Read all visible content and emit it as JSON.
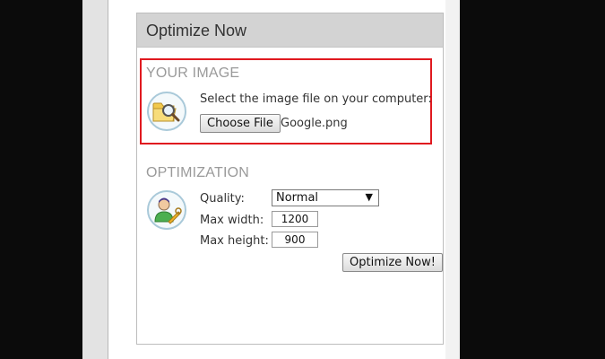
{
  "panel": {
    "title": "Optimize Now"
  },
  "your_image": {
    "title": "YOUR IMAGE",
    "instruction": "Select the image file on your computer:",
    "choose_button": "Choose File",
    "file_name": "Google.png",
    "icon": "folder-search-icon"
  },
  "optimization": {
    "title": "OPTIMIZATION",
    "icon": "user-settings-icon",
    "quality_label": "Quality:",
    "quality_value": "Normal",
    "max_width_label": "Max width:",
    "max_width_value": "1200",
    "max_height_label": "Max height:",
    "max_height_value": "900",
    "submit_button": "Optimize Now!"
  },
  "colors": {
    "highlight": "#e0191f",
    "header_bg": "#d3d3d3",
    "section_title": "#9a9a9a"
  }
}
